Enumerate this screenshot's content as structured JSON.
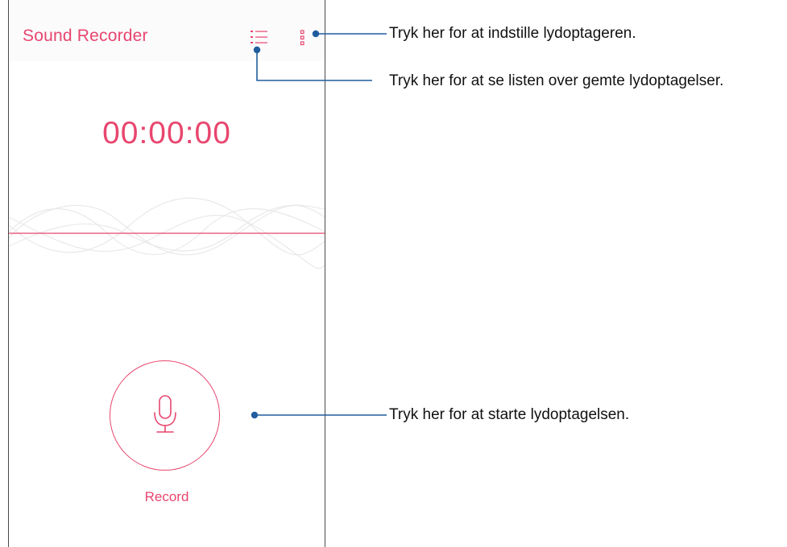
{
  "app": {
    "title": "Sound Recorder",
    "timer": "00:00:00",
    "record_label": "Record",
    "accent_color": "#e8466f",
    "icons": {
      "list": "list-icon",
      "more": "more-vertical-icon",
      "mic": "microphone-icon"
    }
  },
  "callouts": {
    "settings": "Tryk her for at indstille lydoptageren.",
    "list": "Tryk her for at se listen over gemte lydoptagelser.",
    "record": "Tryk her for at starte lydoptagelsen."
  },
  "colors": {
    "callout_line": "#1f5d9e",
    "frame": "#4a4a4a"
  }
}
